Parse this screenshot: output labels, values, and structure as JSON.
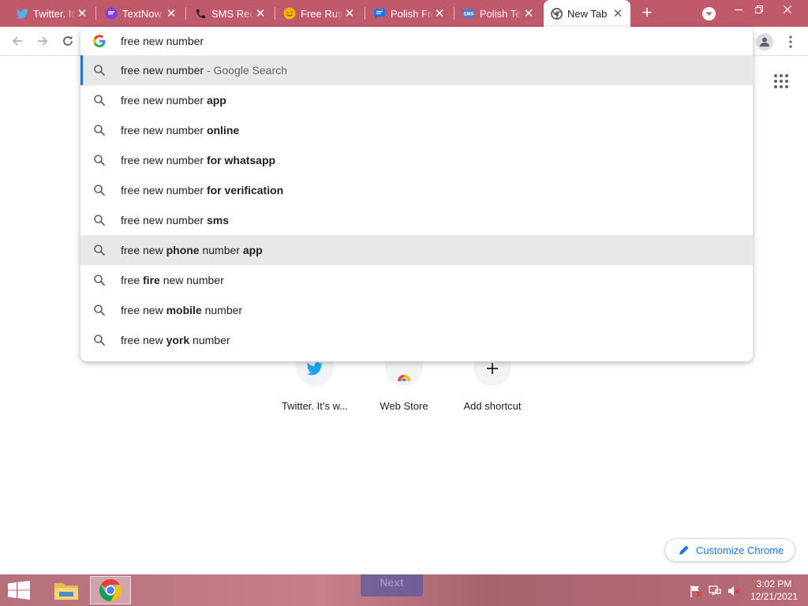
{
  "browser": {
    "tabs": [
      {
        "title": "Twitter. It's what's happening",
        "icon": "twitter-icon",
        "color": "#1da1f2"
      },
      {
        "title": "TextNow",
        "icon": "textnow-icon",
        "color": "#7b3fe4"
      },
      {
        "title": "SMS Receive Free",
        "icon": "phone-icon",
        "color": "#222222"
      },
      {
        "title": "Free Russian Number",
        "icon": "smiley-icon",
        "color": "#f4b400"
      },
      {
        "title": "Polish Free Number",
        "icon": "chat-bubble-icon",
        "color": "#1a73e8"
      },
      {
        "title": "Polish Temp Number",
        "icon": "sms-icon",
        "color": "#4a7bd0"
      },
      {
        "title": "New Tab",
        "icon": "chrome-icon",
        "color": "#5f6368",
        "active": true
      }
    ],
    "tab_close_glyph": "✕",
    "new_tab_glyph": "+"
  },
  "omnibox": {
    "query": "free new number",
    "suggestions": [
      {
        "prefix": "free new number",
        "bold": "",
        "suffix": " - Google Search",
        "selected": true
      },
      {
        "prefix": "free new number ",
        "bold": "app",
        "suffix": ""
      },
      {
        "prefix": "free new number ",
        "bold": "online",
        "suffix": ""
      },
      {
        "prefix": "free new number ",
        "bold": "for whatsapp",
        "suffix": ""
      },
      {
        "prefix": "free new number ",
        "bold": "for verification",
        "suffix": ""
      },
      {
        "prefix": "free new number ",
        "bold": "sms",
        "suffix": ""
      },
      {
        "parts": [
          [
            "free new ",
            false
          ],
          [
            "phone",
            true
          ],
          [
            " number ",
            false
          ],
          [
            "app",
            true
          ]
        ],
        "hovered": true
      },
      {
        "parts": [
          [
            "free ",
            false
          ],
          [
            "fire",
            true
          ],
          [
            " new number",
            false
          ]
        ]
      },
      {
        "parts": [
          [
            "free new ",
            false
          ],
          [
            "mobile",
            true
          ],
          [
            " number",
            false
          ]
        ]
      },
      {
        "parts": [
          [
            "free new ",
            false
          ],
          [
            "york",
            true
          ],
          [
            " number",
            false
          ]
        ]
      }
    ]
  },
  "ntp": {
    "shortcuts": [
      {
        "label": "Twitter. It’s w...",
        "icon": "twitter-icon"
      },
      {
        "label": "Web Store",
        "icon": "chrome-web-store-icon"
      },
      {
        "label": "Add shortcut",
        "icon": "plus-icon"
      }
    ],
    "customize_label": "Customize Chrome"
  },
  "taskbar": {
    "ghost_button_label": "Next",
    "clock_time": "3:02 PM",
    "clock_date": "12/21/2021"
  },
  "colors": {
    "accent": "#1a73e8",
    "tabstrip": "#c0596a",
    "taskbar": "#b5707c"
  }
}
